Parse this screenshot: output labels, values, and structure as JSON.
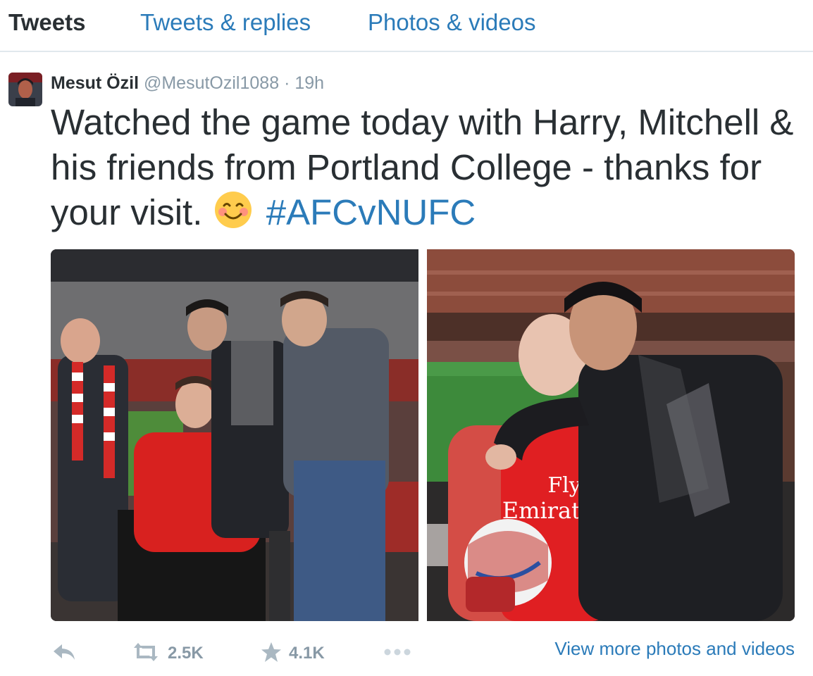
{
  "tabs": [
    {
      "label": "Tweets",
      "active": true
    },
    {
      "label": "Tweets & replies",
      "active": false
    },
    {
      "label": "Photos & videos",
      "active": false
    }
  ],
  "tweet": {
    "author_name": "Mesut Özil",
    "handle": "@MesutOzil1088",
    "separator": "·",
    "time": "19h",
    "text": "Watched the game today with Harry, Mitchell & his friends from Portland College - thanks for your visit.",
    "emoji": "smiling-face-with-blush",
    "hashtag": "#AFCvNUFC",
    "shirt_text_line1": "Fly",
    "shirt_text_line2": "Emirates"
  },
  "actions": {
    "reply_icon": "reply-icon",
    "retweet_icon": "retweet-icon",
    "retweet_count": "2.5K",
    "favorite_icon": "star-icon",
    "favorite_count": "4.1K",
    "more_icon": "more-dots-icon",
    "view_more": "View more photos and videos"
  },
  "colors": {
    "link": "#2b7bb9",
    "text": "#292f33",
    "muted": "#8899a6",
    "divider": "#e1e8ed"
  }
}
